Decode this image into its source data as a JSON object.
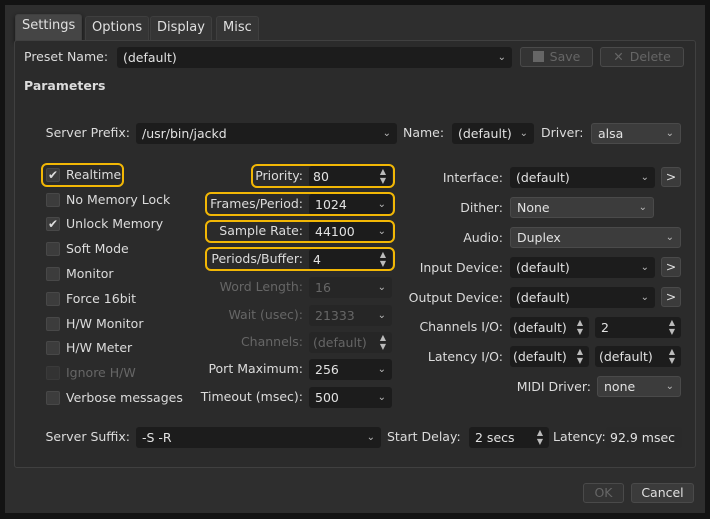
{
  "tabs": [
    "Settings",
    "Options",
    "Display",
    "Misc"
  ],
  "preset": {
    "label": "Preset Name:",
    "value": "(default)",
    "save": "Save",
    "delete": "Delete"
  },
  "parameters_title": "Parameters",
  "server_prefix": {
    "label": "Server Prefix:",
    "value": "/usr/bin/jackd"
  },
  "name": {
    "label": "Name:",
    "value": "(default)"
  },
  "driver": {
    "label": "Driver:",
    "value": "alsa"
  },
  "checkboxes": [
    {
      "label": "Realtime",
      "checked": true,
      "enabled": true
    },
    {
      "label": "No Memory Lock",
      "checked": false,
      "enabled": true
    },
    {
      "label": "Unlock Memory",
      "checked": true,
      "enabled": true
    },
    {
      "label": "Soft Mode",
      "checked": false,
      "enabled": true
    },
    {
      "label": "Monitor",
      "checked": false,
      "enabled": true
    },
    {
      "label": "Force 16bit",
      "checked": false,
      "enabled": true
    },
    {
      "label": "H/W Monitor",
      "checked": false,
      "enabled": true
    },
    {
      "label": "H/W Meter",
      "checked": false,
      "enabled": true
    },
    {
      "label": "Ignore H/W",
      "checked": false,
      "enabled": false
    },
    {
      "label": "Verbose messages",
      "checked": false,
      "enabled": true
    }
  ],
  "mid": [
    {
      "label": "Priority:",
      "value": "80",
      "type": "spin",
      "enabled": true
    },
    {
      "label": "Frames/Period:",
      "value": "1024",
      "type": "combo",
      "enabled": true
    },
    {
      "label": "Sample Rate:",
      "value": "44100",
      "type": "combo",
      "enabled": true
    },
    {
      "label": "Periods/Buffer:",
      "value": "4",
      "type": "spin",
      "enabled": true
    },
    {
      "label": "Word Length:",
      "value": "16",
      "type": "combo",
      "enabled": false
    },
    {
      "label": "Wait (usec):",
      "value": "21333",
      "type": "combo",
      "enabled": false
    },
    {
      "label": "Channels:",
      "value": "(default)",
      "type": "spin",
      "enabled": false
    },
    {
      "label": "Port Maximum:",
      "value": "256",
      "type": "combo",
      "enabled": true
    },
    {
      "label": "Timeout (msec):",
      "value": "500",
      "type": "combo",
      "enabled": true
    }
  ],
  "right": {
    "interface": {
      "label": "Interface:",
      "value": "(default)",
      "button": ">"
    },
    "dither": {
      "label": "Dither:",
      "value": "None"
    },
    "audio": {
      "label": "Audio:",
      "value": "Duplex"
    },
    "input_device": {
      "label": "Input Device:",
      "value": "(default)",
      "button": ">"
    },
    "output_device": {
      "label": "Output Device:",
      "value": "(default)",
      "button": ">"
    },
    "channels_io": {
      "label": "Channels I/O:",
      "in": "(default)",
      "out": "2"
    },
    "latency_io": {
      "label": "Latency I/O:",
      "in": "(default)",
      "out": "(default)"
    },
    "midi_driver": {
      "label": "MIDI Driver:",
      "value": "none"
    }
  },
  "server_suffix": {
    "label": "Server Suffix:",
    "value": "-S -R"
  },
  "start_delay": {
    "label": "Start Delay:",
    "value": "2 secs"
  },
  "latency": {
    "label": "Latency:",
    "value": "92.9 msec"
  },
  "footer": {
    "ok": "OK",
    "cancel": "Cancel"
  },
  "highlight_color": "#f2b705"
}
